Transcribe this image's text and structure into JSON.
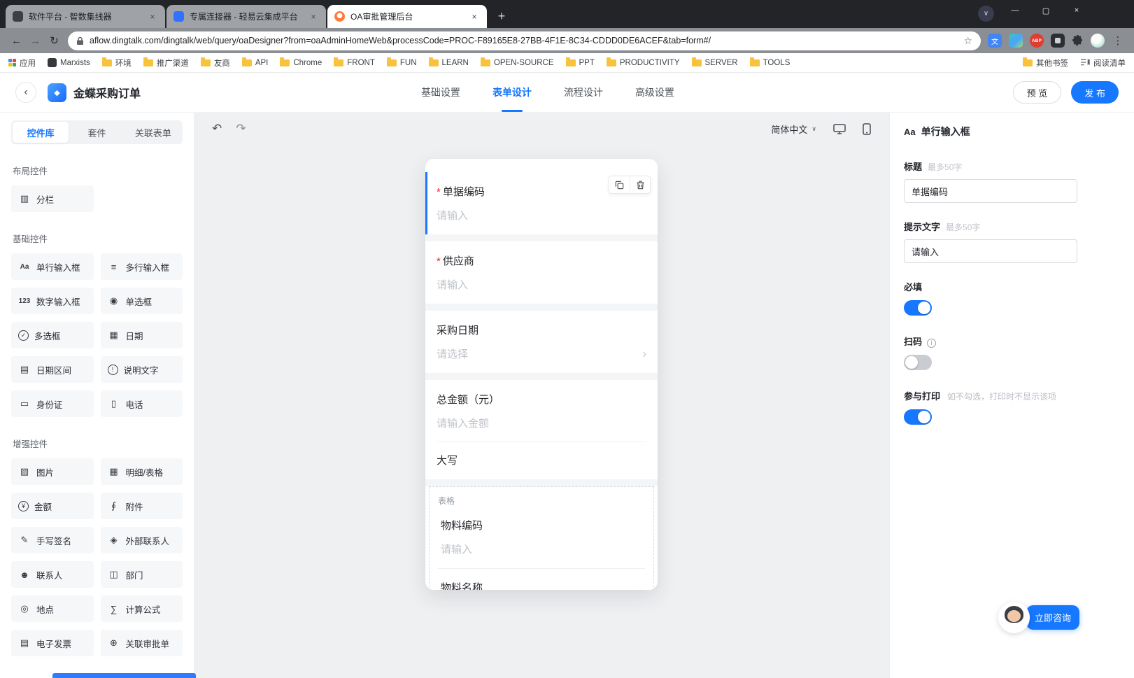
{
  "window": {
    "tabs": [
      {
        "title": "软件平台 - 智数集线器"
      },
      {
        "title": "专属连接器 - 轻易云集成平台"
      },
      {
        "title": "OA审批管理后台"
      }
    ],
    "url": "aflow.dingtalk.com/dingtalk/web/query/oaDesigner?from=oaAdminHomeWeb&processCode=PROC-F89165E8-27BB-4F1E-8C34-CDDD0DE6ACEF&tab=form#/",
    "bookmarks": [
      "应用",
      "Marxists",
      "环境",
      "推广渠道",
      "友商",
      "API",
      "Chrome",
      "FRONT",
      "FUN",
      "LEARN",
      "OPEN-SOURCE",
      "PPT",
      "PRODUCTIVITY",
      "SERVER",
      "TOOLS"
    ],
    "other_bookmarks": "其他书签",
    "reading_list": "阅读清单",
    "abp": "ABP"
  },
  "glyphs": {
    "back": "←",
    "forward": "→",
    "reload": "↻",
    "star": "☆",
    "menu": "⋮",
    "plus": "+",
    "tab_close": "×",
    "tab_search": "∨",
    "minimize": "—",
    "maximize": "▢",
    "close": "×",
    "undo": "↶",
    "redo": "↷",
    "chevron_down": "∨",
    "chevron_right": "›",
    "asterisk": "*",
    "back_circle": "‹",
    "diamond": "◆",
    "translate": "文"
  },
  "header": {
    "title": "金蝶采购订单",
    "tabs": [
      {
        "label": "基础设置"
      },
      {
        "label": "表单设计"
      },
      {
        "label": "流程设计"
      },
      {
        "label": "高级设置"
      }
    ],
    "preview_label": "预 览",
    "publish_label": "发 布"
  },
  "sidebar": {
    "tabs": [
      {
        "label": "控件库"
      },
      {
        "label": "套件"
      },
      {
        "label": "关联表单"
      }
    ],
    "sections": [
      {
        "title": "布局控件",
        "items": [
          {
            "label": "分栏",
            "glyph": "▥"
          }
        ]
      },
      {
        "title": "基础控件",
        "items": [
          {
            "label": "单行输入框",
            "glyph": "Aa"
          },
          {
            "label": "多行输入框",
            "glyph": "≡"
          },
          {
            "label": "数字输入框",
            "glyph": "123"
          },
          {
            "label": "单选框",
            "glyph": "◉"
          },
          {
            "label": "多选框",
            "glyph": "✓"
          },
          {
            "label": "日期",
            "glyph": "▦"
          },
          {
            "label": "日期区间",
            "glyph": "▤"
          },
          {
            "label": "说明文字",
            "glyph": "!"
          },
          {
            "label": "身份证",
            "glyph": "▭"
          },
          {
            "label": "电话",
            "glyph": "▯"
          }
        ]
      },
      {
        "title": "增强控件",
        "items": [
          {
            "label": "图片",
            "glyph": "▨"
          },
          {
            "label": "明细/表格",
            "glyph": "▦"
          },
          {
            "label": "金额",
            "glyph": "¥"
          },
          {
            "label": "附件",
            "glyph": "∮"
          },
          {
            "label": "手写签名",
            "glyph": "✎"
          },
          {
            "label": "外部联系人",
            "glyph": "◈"
          },
          {
            "label": "联系人",
            "glyph": "☻"
          },
          {
            "label": "部门",
            "glyph": "◫"
          },
          {
            "label": "地点",
            "glyph": "◎"
          },
          {
            "label": "计算公式",
            "glyph": "∑"
          },
          {
            "label": "电子发票",
            "glyph": "▤"
          },
          {
            "label": "关联审批单",
            "glyph": "⊕"
          }
        ]
      }
    ]
  },
  "canvas": {
    "lang": "简体中文",
    "form": {
      "fields": [
        {
          "label": "单据编码",
          "placeholder": "请输入"
        },
        {
          "label": "供应商",
          "placeholder": "请输入"
        },
        {
          "label": "采购日期",
          "placeholder": "请选择"
        },
        {
          "label": "总金额（元）",
          "placeholder": "请输入金额",
          "extra": "大写"
        }
      ],
      "table": {
        "tag": "表格",
        "fields": [
          {
            "label": "物料编码",
            "placeholder": "请输入"
          },
          {
            "label": "物料名称"
          }
        ]
      }
    }
  },
  "inspector": {
    "component": "单行输入框",
    "component_icon": "Aa",
    "title_label": "标题",
    "title_hint": "最多50字",
    "title_value": "单据编码",
    "placeholder_label": "提示文字",
    "placeholder_hint": "最多50字",
    "placeholder_value": "请输入",
    "required_label": "必填",
    "scan_label": "扫码",
    "print_label": "参与打印",
    "print_hint": "如不勾选，打印时不显示该项"
  },
  "support": {
    "label": "立即咨询"
  }
}
